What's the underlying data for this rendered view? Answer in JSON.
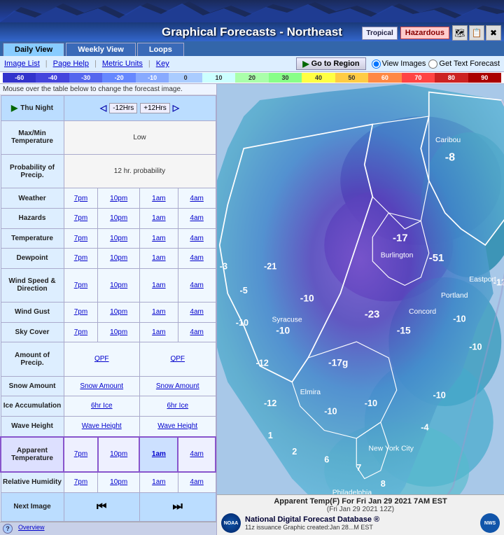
{
  "header": {
    "title": "Graphical Forecasts - Northeast",
    "tropical_label": "Tropical",
    "hazardous_label": "Hazardous"
  },
  "nav": {
    "tabs": [
      {
        "label": "Daily View",
        "active": true
      },
      {
        "label": "Weekly View",
        "active": false
      },
      {
        "label": "Loops",
        "active": false
      }
    ]
  },
  "toolbar": {
    "links": [
      "Image List",
      "Page Help",
      "Metric Units",
      "Key"
    ],
    "goto_region": "Go to Region",
    "view_images": "View Images",
    "get_text_forecast": "Get Text Forecast"
  },
  "color_scale": {
    "labels": [
      "-60",
      "-40",
      "-30",
      "-20",
      "-10",
      "0",
      "10",
      "20",
      "30",
      "40",
      "50",
      "60",
      "70",
      "80",
      "90"
    ],
    "colors": [
      "#3333cc",
      "#4444dd",
      "#5566ee",
      "#6688ff",
      "#88aaff",
      "#aaccff",
      "#ccffff",
      "#aaffaa",
      "#88ff88",
      "#ffff44",
      "#ffcc44",
      "#ff8844",
      "#ff4444",
      "#cc2222",
      "#aa0000"
    ]
  },
  "forecast": {
    "instruction": "Mouse over the table below to change the forecast image.",
    "tonight_label": "Thu Night",
    "prev_hrs": "-12Hrs",
    "next_hrs": "+12Hrs",
    "rows": [
      {
        "label": "Max/Min Temperature",
        "col1": "Low",
        "col2": "",
        "col3": "",
        "col4": ""
      },
      {
        "label": "Probability of Precip.",
        "col1": "12 hr. probability",
        "col2": "",
        "col3": "",
        "col4": ""
      },
      {
        "label": "Weather",
        "col1": "7pm",
        "col2": "10pm",
        "col3": "1am",
        "col4": "4am"
      },
      {
        "label": "Hazards",
        "col1": "7pm",
        "col2": "10pm",
        "col3": "1am",
        "col4": "4am"
      },
      {
        "label": "Temperature",
        "col1": "7pm",
        "col2": "10pm",
        "col3": "1am",
        "col4": "4am"
      },
      {
        "label": "Dewpoint",
        "col1": "7pm",
        "col2": "10pm",
        "col3": "1am",
        "col4": "4am"
      },
      {
        "label": "Wind Speed & Direction",
        "col1": "7pm",
        "col2": "10pm",
        "col3": "1am",
        "col4": "4am"
      },
      {
        "label": "Wind Gust",
        "col1": "7pm",
        "col2": "10pm",
        "col3": "1am",
        "col4": "4am"
      },
      {
        "label": "Sky Cover",
        "col1": "7pm",
        "col2": "10pm",
        "col3": "1am",
        "col4": "4am"
      },
      {
        "label": "Amount of Precip.",
        "col1": "QPF",
        "col2": "",
        "col3": "QPF",
        "col4": ""
      },
      {
        "label": "Snow Amount",
        "col1": "Snow Amount",
        "col2": "",
        "col3": "Snow Amount",
        "col4": ""
      },
      {
        "label": "Ice Accumulation",
        "col1": "6hr Ice",
        "col2": "",
        "col3": "6hr Ice",
        "col4": ""
      },
      {
        "label": "Wave Height",
        "col1": "Wave Height",
        "col2": "",
        "col3": "Wave Height",
        "col4": ""
      },
      {
        "label": "Apparent Temperature",
        "col1": "7pm",
        "col2": "10pm",
        "col3": "1am",
        "col4": "4am",
        "highlighted": true
      },
      {
        "label": "Relative Humidity",
        "col1": "7pm",
        "col2": "10pm",
        "col3": "1am",
        "col4": "4am"
      }
    ],
    "next_image_label": "Next Image",
    "prev_nav": "◀",
    "next_nav": "▶"
  },
  "map": {
    "caption": "Apparent Temp(F) For Fri Jan 29 2021  7AM EST",
    "subcaption": "(Fri Jan 29 2021 12Z)",
    "footer_text": "National Digital Forecast Database ®",
    "source_line": "11z issuance    Graphic created:Jan 28...M EST"
  },
  "bottom_bar": {
    "overview_label": "Overview"
  }
}
